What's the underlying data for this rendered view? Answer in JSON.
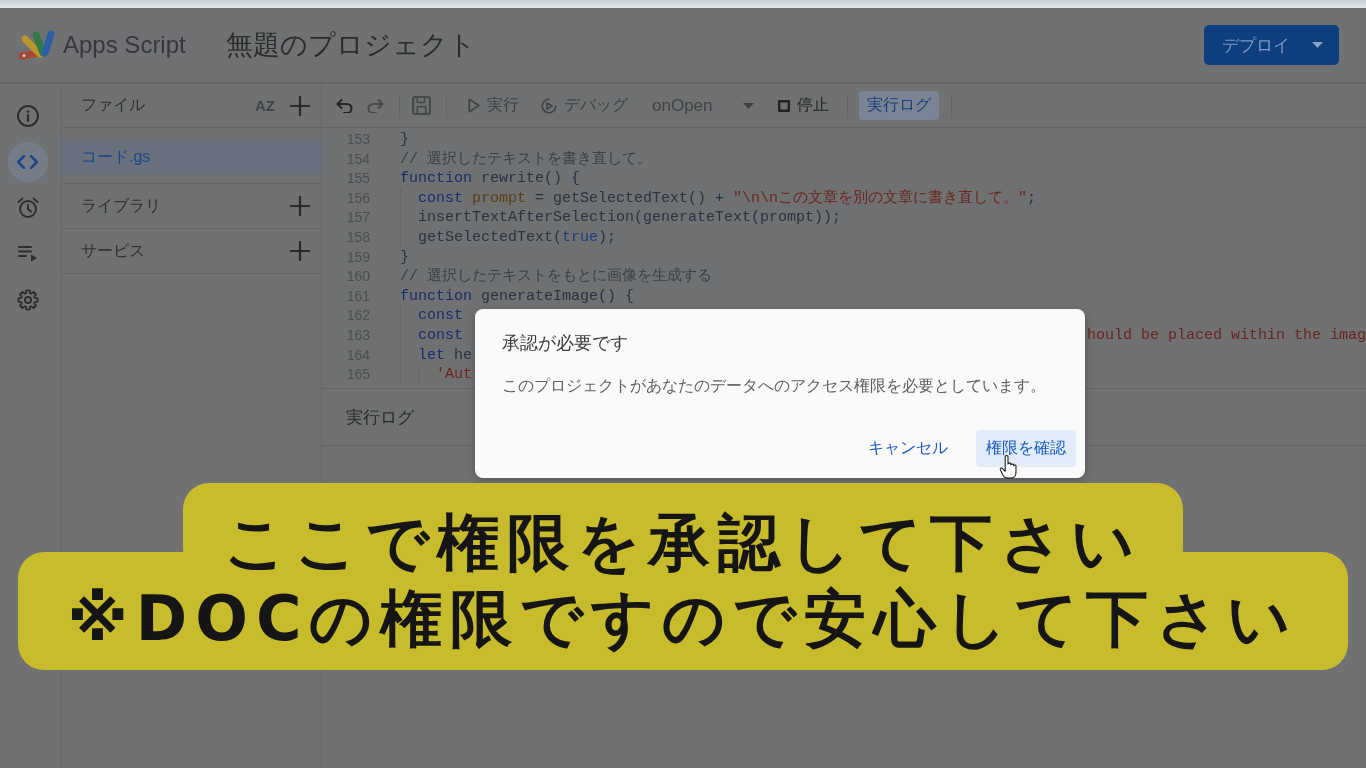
{
  "header": {
    "app_name": "Apps Script",
    "project_title": "無題のプロジェクト",
    "deploy_label": "デプロイ"
  },
  "rail": [
    {
      "kind": "info",
      "selected": false
    },
    {
      "kind": "editor",
      "selected": true
    },
    {
      "kind": "triggers",
      "selected": false
    },
    {
      "kind": "executions",
      "selected": false
    },
    {
      "kind": "settings",
      "selected": false
    }
  ],
  "files_panel": {
    "title": "ファイル",
    "sort_label": "AZ",
    "files": [
      {
        "name": "コード.gs",
        "selected": true
      }
    ],
    "sections": [
      {
        "title": "ライブラリ"
      },
      {
        "title": "サービス"
      }
    ]
  },
  "toolbar": [
    {
      "kind": "undo",
      "disabled": false
    },
    {
      "kind": "redo",
      "disabled": true
    },
    {
      "kind": "divider"
    },
    {
      "kind": "save",
      "disabled": true
    },
    {
      "kind": "divider"
    },
    {
      "kind": "run",
      "label": "実行",
      "disabled": true
    },
    {
      "kind": "debug",
      "label": "デバッグ",
      "disabled": true
    },
    {
      "kind": "function_select",
      "label": "onOpen",
      "disabled": true
    },
    {
      "kind": "stop",
      "label": "停止",
      "disabled": false
    },
    {
      "kind": "divider"
    },
    {
      "kind": "log_toggle",
      "label": "実行ログ",
      "selected": true
    },
    {
      "kind": "divider"
    }
  ],
  "editor": {
    "lines": [
      {
        "number": "153",
        "tokens": [
          {
            "kind": "plain",
            "text": "}"
          }
        ]
      },
      {
        "number": "154",
        "tokens": [
          {
            "kind": "comment",
            "text": "// 選択したテキストを書き直して。"
          }
        ]
      },
      {
        "number": "155",
        "tokens": [
          {
            "kind": "keyword",
            "text": "function"
          },
          {
            "kind": "plain",
            "text": " rewrite() {"
          }
        ],
        "children": [
          {
            "number": "156",
            "tokens": [
              {
                "kind": "keyword",
                "text": "const"
              },
              {
                "kind": "variable",
                "text": " prompt"
              },
              {
                "kind": "plain",
                "text": " = getSelectedText() + "
              },
              {
                "kind": "string",
                "text": "\"\\n\\nこの文章を別の文章に書き直して。\""
              },
              {
                "kind": "plain",
                "text": ";"
              }
            ]
          },
          {
            "number": "157",
            "tokens": [
              {
                "kind": "plain",
                "text": "insertTextAfterSelection(generateText(prompt));"
              }
            ]
          },
          {
            "number": "158",
            "tokens": [
              {
                "kind": "plain",
                "text": "getSelectedText("
              },
              {
                "kind": "literal",
                "text": "true"
              },
              {
                "kind": "plain",
                "text": ");"
              }
            ]
          }
        ]
      },
      {
        "number": "159",
        "tokens": [
          {
            "kind": "plain",
            "text": "}"
          }
        ]
      },
      {
        "number": "160",
        "tokens": [
          {
            "kind": "comment",
            "text": "// 選択したテキストをもとに画像を生成する"
          }
        ]
      },
      {
        "number": "161",
        "tokens": [
          {
            "kind": "keyword",
            "text": "function"
          },
          {
            "kind": "plain",
            "text": " generateImage() {"
          }
        ],
        "children": [
          {
            "number": "162",
            "tokens": [
              {
                "kind": "keyword",
                "text": "const"
              }
            ]
          },
          {
            "number": "163",
            "tokens": [
              {
                "kind": "keyword",
                "text": "const"
              }
            ],
            "tail": {
              "kind": "string",
              "text": "hould be placed within the imag"
            }
          },
          {
            "number": "164",
            "tokens": [
              {
                "kind": "keyword",
                "text": "let"
              },
              {
                "kind": "plain",
                "text": " he"
              }
            ],
            "children": [
              {
                "number": "165",
                "tokens": [
                  {
                    "kind": "string",
                    "text": "'Aut"
                  }
                ]
              }
            ]
          }
        ]
      }
    ]
  },
  "log_panel": {
    "title": "実行ログ"
  },
  "dialog": {
    "title": "承認が必要です",
    "message": "このプロジェクトがあなたのデータへのアクセス権限を必要としています。",
    "buttons": [
      {
        "label": "キャンセル",
        "hovered": false
      },
      {
        "label": "権限を確認",
        "hovered": true
      }
    ]
  },
  "caption": {
    "lines": [
      "ここで権限を承認して下さい",
      "※DOCの権限ですので安心して下さい"
    ]
  }
}
